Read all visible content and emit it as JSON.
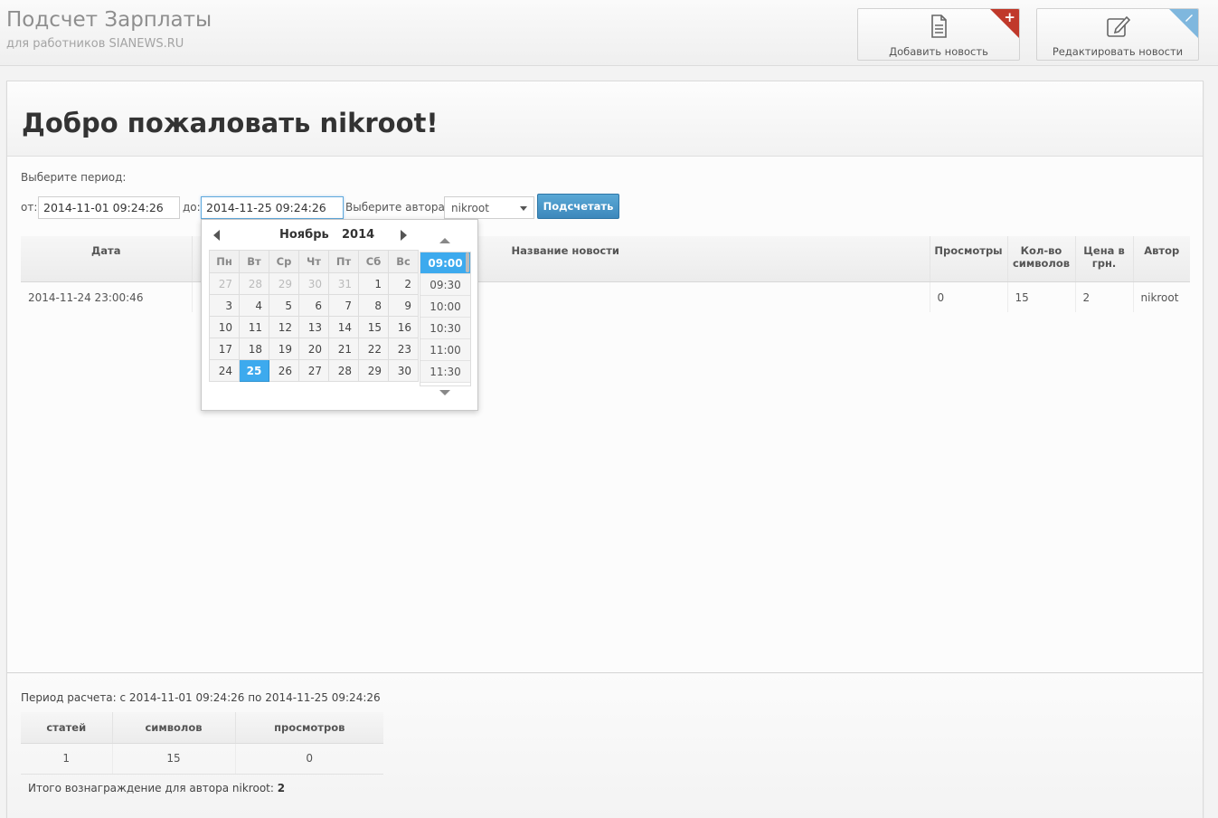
{
  "header": {
    "title": "Подсчет Зарплаты",
    "subtitle": "для работников SIANEWS.RU",
    "add_button": "Добавить новость",
    "edit_button": "Редактировать новости",
    "add_corner_color": "#c0392b",
    "edit_corner_color": "#7fb7de"
  },
  "main": {
    "welcome": "Добро пожаловать nikroot!",
    "period_label": "Выберите период:",
    "from_label": "от:",
    "from_value": "2014-11-01 09:24:26",
    "to_label": "до:",
    "to_value": "2014-11-25 09:24:26",
    "author_label": "Выберите автора:",
    "author_value": "nikroot",
    "calc_button": "Подсчетать",
    "accent_color": "#3daaee"
  },
  "table": {
    "headers": [
      "Дата",
      "",
      "Название новости",
      "Просмотры",
      "Кол-во символов",
      "Цена в грн.",
      "Автор"
    ],
    "rows": [
      [
        "2014-11-24 23:00:46",
        "",
        "",
        "0",
        "15",
        "2",
        "nikroot"
      ]
    ]
  },
  "datepicker": {
    "month": "Ноябрь",
    "year": "2014",
    "weekdays": [
      "Пн",
      "Вт",
      "Ср",
      "Чт",
      "Пт",
      "Сб",
      "Вс"
    ],
    "weeks": [
      [
        "27",
        "28",
        "29",
        "30",
        "31",
        "1",
        "2"
      ],
      [
        "3",
        "4",
        "5",
        "6",
        "7",
        "8",
        "9"
      ],
      [
        "10",
        "11",
        "12",
        "13",
        "14",
        "15",
        "16"
      ],
      [
        "17",
        "18",
        "19",
        "20",
        "21",
        "22",
        "23"
      ],
      [
        "24",
        "25",
        "26",
        "27",
        "28",
        "29",
        "30"
      ]
    ],
    "selected_day": "25",
    "times": [
      "09:00",
      "09:30",
      "10:00",
      "10:30",
      "11:00",
      "11:30"
    ],
    "selected_time": "09:00"
  },
  "summary": {
    "period_text": "Период расчета: с 2014-11-01 09:24:26 по 2014-11-25 09:24:26",
    "headers": [
      "статей",
      "символов",
      "просмотров"
    ],
    "values": [
      "1",
      "15",
      "0"
    ],
    "total_label": "Итого вознаграждение для автора nikroot:",
    "total_value": "2"
  }
}
